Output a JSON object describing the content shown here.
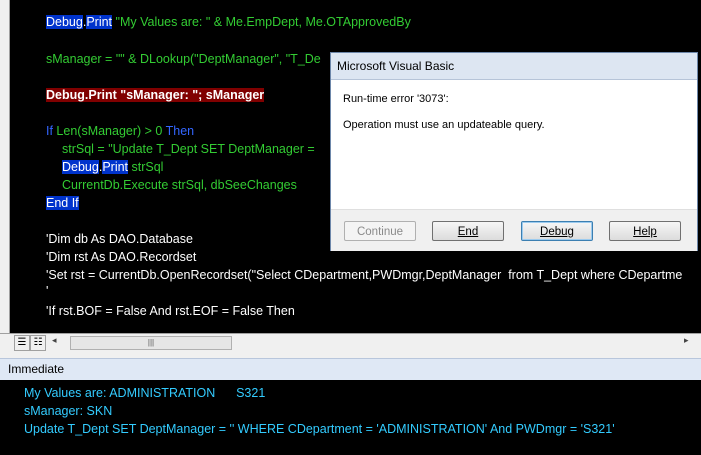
{
  "code": {
    "line1": {
      "kw": "Debug",
      "dot": ".",
      "kw2": "Print",
      "rest": " \"My Values are: \" & Me.EmpDept, Me.OTApprovedBy"
    },
    "line2": "sManager = \"\" & DLookup(\"DeptManager\", \"T_De",
    "line3_breakpoint": "Debug.Print \"sManager: \"; sManager",
    "line4": {
      "kw_if": "If",
      "mid": " Len(sManager) > 0 ",
      "kw_then": "Then"
    },
    "line5": "strSql = \"Update T_Dept SET DeptManager = ",
    "line6": {
      "kw": "Debug",
      "dot": ".",
      "kw2": "Print",
      "rest": " strSql"
    },
    "line7": "CurrentDb.Execute strSql, dbSeeChanges",
    "line8": {
      "kw": "End If"
    },
    "line9": "'Dim db As DAO.Database",
    "line10": "'Dim rst As DAO.Recordset",
    "line11": "'Set rst = CurrentDb.OpenRecordset(\"Select CDepartment,PWDmgr,DeptManager  from T_Dept where CDepartme",
    "line12": "'",
    "line13": "'If rst.BOF = False And rst.EOF = False Then"
  },
  "scrollbar": {
    "left_arrow": "◂",
    "thumb_grip": "|||",
    "right_arrow": "▸"
  },
  "immediate": {
    "title": "Immediate",
    "lines": [
      "My Values are: ADMINISTRATION      S321",
      "sManager: SKN",
      "Update T_Dept SET DeptManager = '' WHERE CDepartment = 'ADMINISTRATION' And PWDmgr = 'S321'"
    ]
  },
  "dialog": {
    "title": "Microsoft Visual Basic",
    "error_line": "Run-time error '3073':",
    "message": "Operation must use an updateable query.",
    "buttons": {
      "continue": "Continue",
      "end": "End",
      "debug": "Debug",
      "help": "Help"
    }
  },
  "colors": {
    "editor_bg": "#000000",
    "keyword_highlight": "#0033cc",
    "breakpoint": "#800000",
    "code_green": "#33cc33",
    "immediate_text": "#33ccff"
  },
  "icons": [
    "breakpoint-dot",
    "procedure-view-icon",
    "full-module-view-icon"
  ]
}
